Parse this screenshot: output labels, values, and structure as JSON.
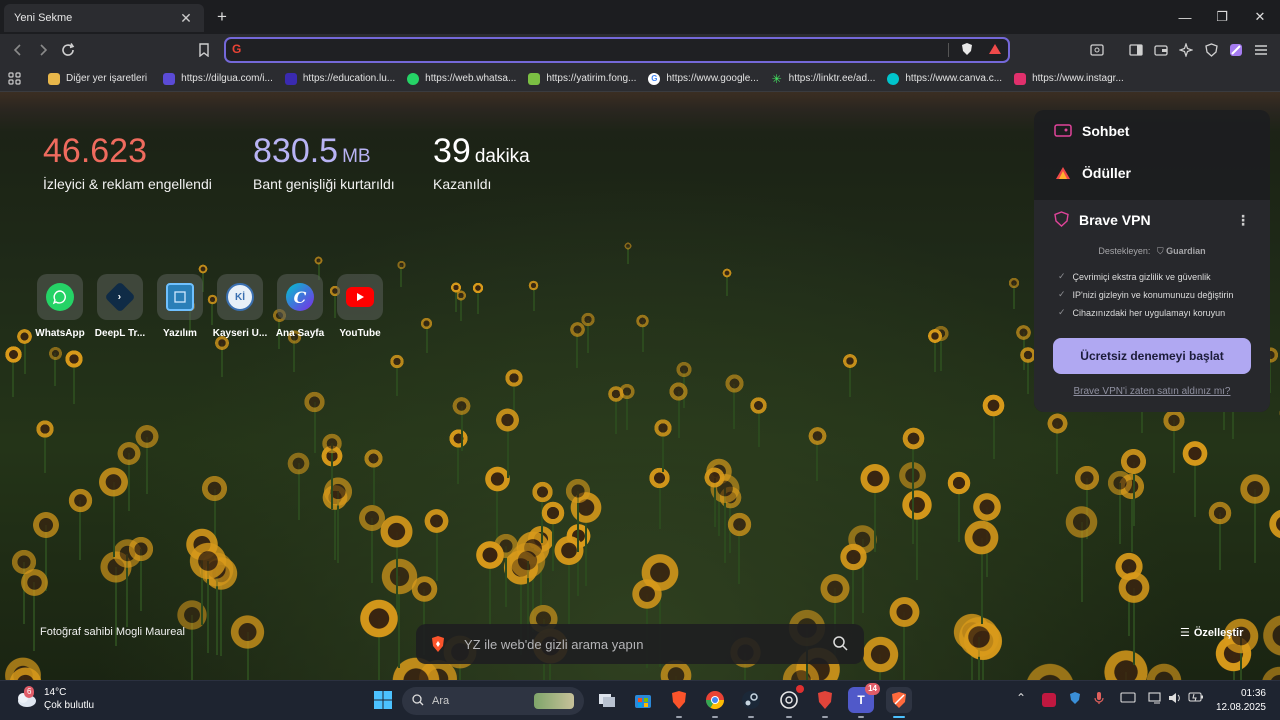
{
  "tab": {
    "title": "Yeni Sekme"
  },
  "bookmarks": [
    {
      "label": "Diğer yer işaretleri",
      "icon": "folder-icon",
      "color": "#e8b74a"
    },
    {
      "label": "https://dilgua.com/i...",
      "icon": "dilgua-icon",
      "color": "#5b4bd6"
    },
    {
      "label": "https://education.lu...",
      "icon": "education-icon",
      "color": "#3a2ab0"
    },
    {
      "label": "https://web.whatsa...",
      "icon": "whatsapp-icon",
      "color": "#25d366"
    },
    {
      "label": "https://yatirim.fong...",
      "icon": "yatirim-icon",
      "color": "#7bbf43"
    },
    {
      "label": "https://www.google...",
      "icon": "google-icon",
      "color": "#ffffff"
    },
    {
      "label": "https://linktr.ee/ad...",
      "icon": "linktree-icon",
      "color": "#43e660"
    },
    {
      "label": "https://www.canva.c...",
      "icon": "canva-icon",
      "color": "#00c4cc"
    },
    {
      "label": "https://www.instagr...",
      "icon": "instagram-icon",
      "color": "#e1306c"
    }
  ],
  "stats": {
    "trackers": {
      "value": "46.623",
      "label": "İzleyici & reklam engellendi",
      "color": "#ef6b5e"
    },
    "bandwidth": {
      "value": "830.5",
      "unit": "MB",
      "label": "Bant genişliği kurtarıldı",
      "color": "#b8b3f4"
    },
    "time": {
      "value": "39",
      "unit": "dakika",
      "label": "Kazanıldı",
      "color": "#ffffff"
    }
  },
  "top_sites": [
    {
      "name": "WhatsApp",
      "icon": "whatsapp-icon",
      "color": "#25d366"
    },
    {
      "name": "DeepL Tr...",
      "icon": "deepl-icon",
      "color": "#0f2b46"
    },
    {
      "name": "Yazılım",
      "icon": "yazilim-icon",
      "color": "#2a7fb8"
    },
    {
      "name": "Kayseri Ü...",
      "icon": "kayseri-icon",
      "color": "#3a6fb0"
    },
    {
      "name": "Ana Sayfa",
      "icon": "canva-icon",
      "color": "#7d2ae8"
    },
    {
      "name": "YouTube",
      "icon": "youtube-icon",
      "color": "#ff0000"
    }
  ],
  "panel": {
    "chat": "Sohbet",
    "rewards": "Ödüller",
    "vpn_title": "Brave VPN",
    "supported_by": "Destekleyen:",
    "supporter": "Guardian",
    "features": [
      "Çevrimiçi ekstra gizlilik ve güvenlik",
      "IP'nizi gizleyin ve konumunuzu değiştirin",
      "Cihazınızdaki her uygulamayı koruyun"
    ],
    "trial_button": "Ücretsiz denemeyi başlat",
    "bought_link": "Brave VPN'i zaten satın aldınız mı?"
  },
  "footer": {
    "photo_credit": "Fotoğraf sahibi Mogli Maureal",
    "search_placeholder": "YZ ile web'de gizli arama yapın",
    "customize": "Özelleştir"
  },
  "taskbar": {
    "weather_temp": "14°C",
    "weather_desc": "Çok bulutlu",
    "weather_badge": "6",
    "search_label": "Ara",
    "teams_badge": "14",
    "time": "01:36",
    "date": "12.08.2025"
  }
}
